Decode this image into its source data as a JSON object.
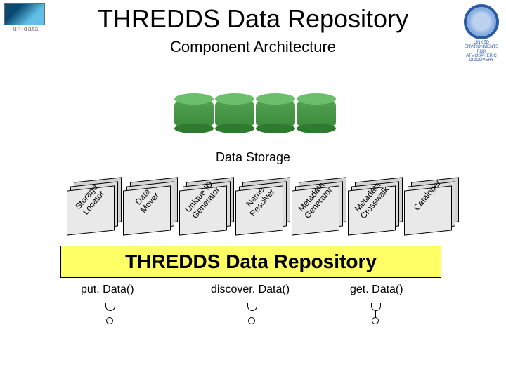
{
  "title": "THREDDS Data Repository",
  "subtitle": "Component Architecture",
  "storage_label": "Data Storage",
  "logos": {
    "left_caption": "unidata",
    "right_caption": "LINKED\nENVIRONMENTS\nFOR ATMOSPHERIC\nDISCOVERY"
  },
  "modules": [
    {
      "label": "Storage\nLocator"
    },
    {
      "label": "Data\nMover"
    },
    {
      "label": "Unique ID\nGenerator"
    },
    {
      "label": "Name\nResolver"
    },
    {
      "label": "Metadata\nGenerator"
    },
    {
      "label": "Metadata\nCrosswalk"
    },
    {
      "label": "Cataloger"
    }
  ],
  "repository_label": "THREDDS Data Repository",
  "methods": [
    {
      "name": "put. Data()"
    },
    {
      "name": "discover. Data()"
    },
    {
      "name": "get. Data()"
    }
  ],
  "chart_data": {
    "type": "table",
    "title": "THREDDS Data Repository — Component Architecture",
    "components": [
      "Storage Locator",
      "Data Mover",
      "Unique ID Generator",
      "Name Resolver",
      "Metadata Generator",
      "Metadata Crosswalk",
      "Cataloger"
    ],
    "interfaces": [
      "put.Data()",
      "discover.Data()",
      "get.Data()"
    ],
    "external": [
      "Data Storage"
    ],
    "storage_cylinder_count": 4
  }
}
